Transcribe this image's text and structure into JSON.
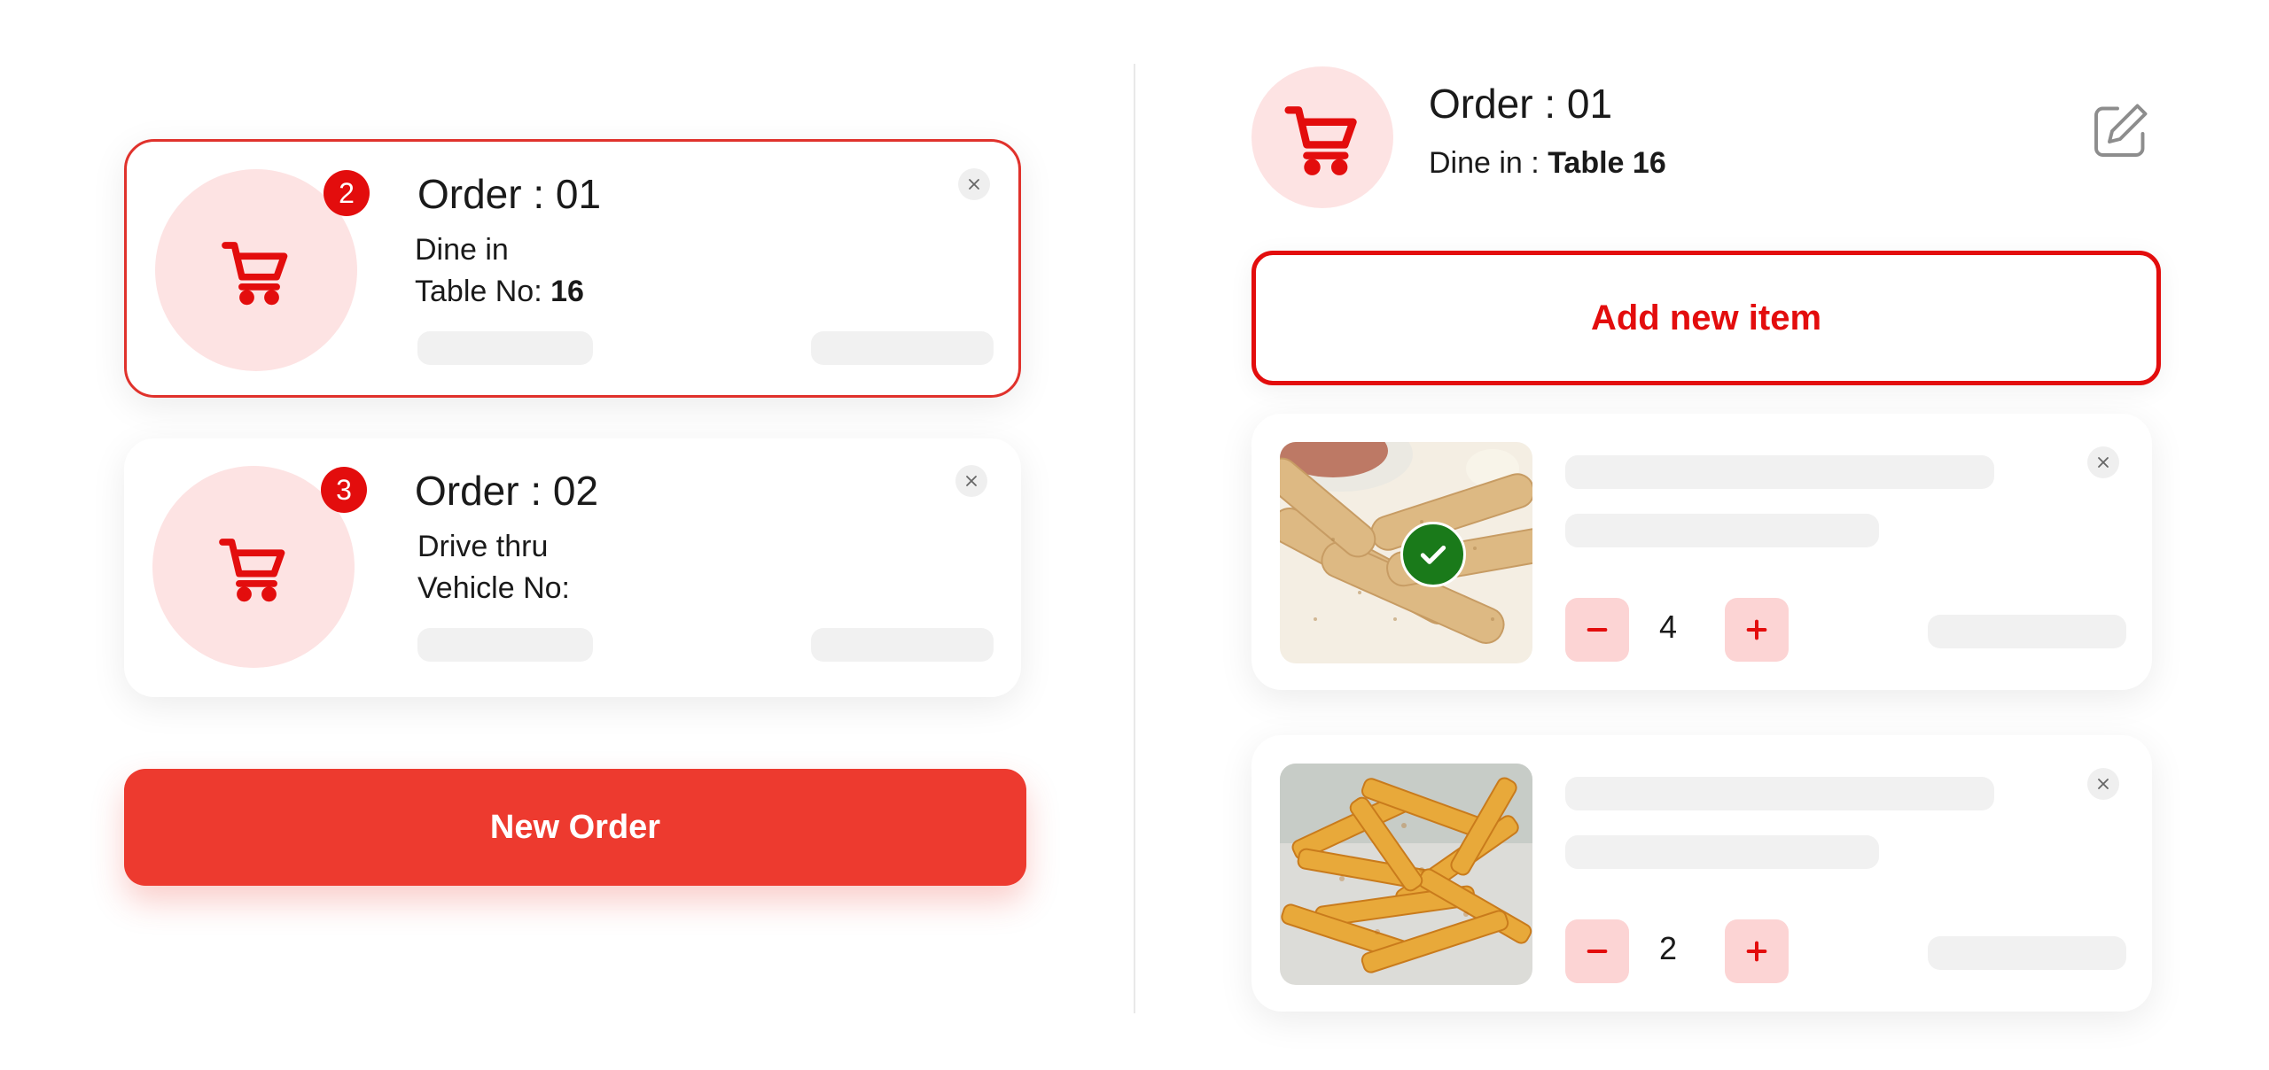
{
  "orders": [
    {
      "title": "Order : 01",
      "badge": "2",
      "line1": "Dine in",
      "line2_label": "Table No: ",
      "line2_value": "16",
      "active": true
    },
    {
      "title": "Order : 02",
      "badge": "3",
      "line1": "Drive thru",
      "line2_label": "Vehicle No:",
      "line2_value": "",
      "active": false
    }
  ],
  "new_order_label": "New Order",
  "detail": {
    "title": "Order : 01",
    "sub_label": "Dine in : ",
    "sub_value": "Table 16",
    "add_item_label": "Add new item",
    "items": [
      {
        "image": "mozzarella-sticks-image",
        "quantity": "4",
        "selected": true
      },
      {
        "image": "french-fries-image",
        "quantity": "2",
        "selected": false
      }
    ]
  },
  "colors": {
    "accent": "#e30d0d",
    "button": "#ed3a2f",
    "soft": "#fde3e3",
    "qty_bg": "#fcd4d4",
    "success": "#1a7a1a",
    "skeleton": "#f1f1f1"
  },
  "icons": [
    "cart-icon",
    "close-icon",
    "edit-icon",
    "minus-icon",
    "plus-icon",
    "check-icon"
  ]
}
